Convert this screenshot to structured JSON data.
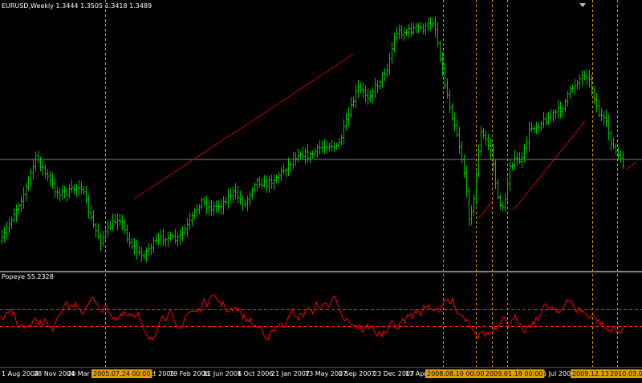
{
  "main_window": {
    "symbol": "EURUSD,Weekly",
    "ohlc": "1.3444 1.3505 1.3418 1.3489"
  },
  "indicator_window": {
    "label": "Popeye 55.2328"
  },
  "time_axis": {
    "labels": [
      "1 Aug 2004",
      "28 Nov 2004",
      "20 Mar",
      "30 Oct 2005",
      "19 Feb 2006",
      "11 Jun 2006",
      "1 Oct 2006",
      "21 Jan 2007",
      "13 May 2007",
      "2 Sep 2007",
      "23 Dec 2007",
      "13 Apr",
      "5 Jul 2009"
    ],
    "highlighted_dates": [
      "2005.07.24 00:00",
      "2008.08.10 00:00",
      "2009.01.18 00:00",
      "2009.12.13",
      "2010.03.07 00:00"
    ],
    "partial_labels": [
      "8.1",
      "009"
    ]
  },
  "colors": {
    "background": "#000000",
    "bull_bars": "#00c000",
    "trendline": "#c00000",
    "indicator_line": "#ff0000",
    "indicator_levels": "#ff2020",
    "price_level_line": "#7f7f7f",
    "vertical_markers": "#e0a000",
    "date_marker_background": "#e0a000",
    "panel_separator": "#bfbfbf"
  }
}
